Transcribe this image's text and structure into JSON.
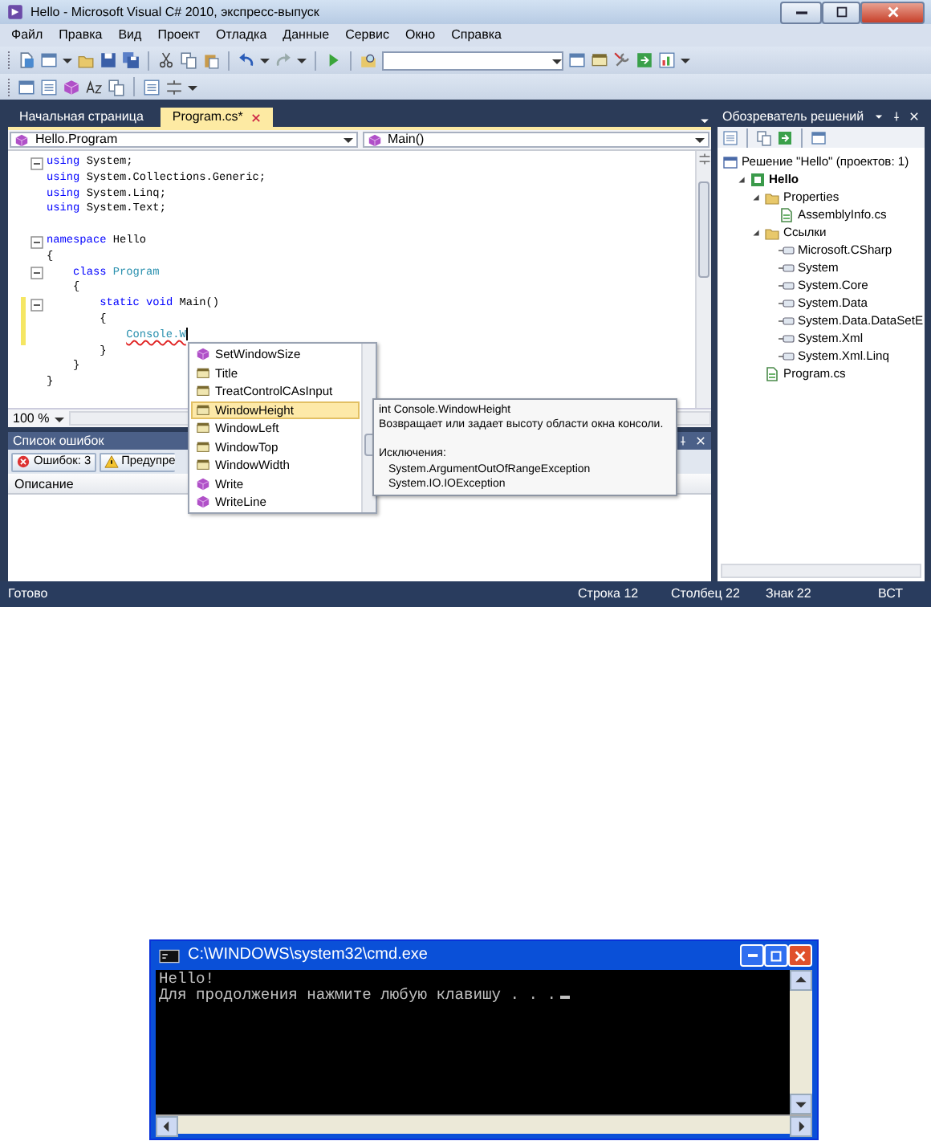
{
  "ide": {
    "title": "Hello - Microsoft Visual C# 2010, экспресс-выпуск",
    "menu": [
      "Файл",
      "Правка",
      "Вид",
      "Проект",
      "Отладка",
      "Данные",
      "Сервис",
      "Окно",
      "Справка"
    ],
    "tabs": [
      {
        "label": "Начальная страница",
        "selected": false
      },
      {
        "label": "Program.cs*",
        "selected": true
      }
    ],
    "editor": {
      "type_combo": "Hello.Program",
      "member_combo": "Main()",
      "zoom": "100 %",
      "lines": [
        {
          "fold": true,
          "changed": false,
          "tokens": [
            {
              "text": "using",
              "kind": "keyword"
            },
            {
              "text": " System;",
              "kind": "plain"
            }
          ]
        },
        {
          "fold": false,
          "changed": false,
          "tokens": [
            {
              "text": "using",
              "kind": "keyword"
            },
            {
              "text": " System.Collections.Generic;",
              "kind": "plain"
            }
          ]
        },
        {
          "fold": false,
          "changed": false,
          "tokens": [
            {
              "text": "using",
              "kind": "keyword"
            },
            {
              "text": " System.Linq;",
              "kind": "plain"
            }
          ]
        },
        {
          "fold": false,
          "changed": false,
          "tokens": [
            {
              "text": "using",
              "kind": "keyword"
            },
            {
              "text": " System.Text;",
              "kind": "plain"
            }
          ]
        },
        {
          "fold": true,
          "changed": false,
          "blank_before": true,
          "tokens": [
            {
              "text": "namespace",
              "kind": "keyword"
            },
            {
              "text": " Hello",
              "kind": "plain"
            }
          ]
        },
        {
          "fold": false,
          "changed": false,
          "tokens": [
            {
              "text": "{",
              "kind": "plain"
            }
          ]
        },
        {
          "fold": true,
          "changed": false,
          "tokens": [
            {
              "text": "    class",
              "kind": "keyword"
            },
            {
              "text": " Program",
              "kind": "type"
            }
          ]
        },
        {
          "fold": false,
          "changed": false,
          "tokens": [
            {
              "text": "    {",
              "kind": "plain"
            }
          ]
        },
        {
          "fold": true,
          "changed": true,
          "tokens": [
            {
              "text": "        static void",
              "kind": "keyword"
            },
            {
              "text": " Main()",
              "kind": "plain"
            }
          ]
        },
        {
          "fold": false,
          "changed": true,
          "tokens": [
            {
              "text": "        {",
              "kind": "plain"
            }
          ]
        },
        {
          "fold": false,
          "changed": true,
          "tokens": [
            {
              "text": "            Console.W",
              "kind": "error"
            }
          ]
        },
        {
          "fold": false,
          "changed": false,
          "tokens": [
            {
              "text": "        }",
              "kind": "plain"
            }
          ]
        },
        {
          "fold": false,
          "changed": false,
          "tokens": [
            {
              "text": "    }",
              "kind": "plain"
            }
          ]
        },
        {
          "fold": false,
          "changed": false,
          "tokens": [
            {
              "text": "}",
              "kind": "plain"
            }
          ]
        }
      ]
    },
    "completion": {
      "items": [
        {
          "label": "SetWindowSize",
          "kind": "method",
          "selected": false
        },
        {
          "label": "Title",
          "kind": "property",
          "selected": false
        },
        {
          "label": "TreatControlCAsInput",
          "kind": "property",
          "selected": false
        },
        {
          "label": "WindowHeight",
          "kind": "property",
          "selected": true
        },
        {
          "label": "WindowLeft",
          "kind": "property",
          "selected": false
        },
        {
          "label": "WindowTop",
          "kind": "property",
          "selected": false
        },
        {
          "label": "WindowWidth",
          "kind": "property",
          "selected": false
        },
        {
          "label": "Write",
          "kind": "method",
          "selected": false
        },
        {
          "label": "WriteLine",
          "kind": "method",
          "selected": false
        }
      ]
    },
    "tooltip": {
      "signature": "int Console.WindowHeight",
      "description": "Возвращает или задает высоту области окна консоли.",
      "exceptions_heading": "Исключения:",
      "exceptions": [
        "System.ArgumentOutOfRangeException",
        "System.IO.IOException"
      ]
    },
    "error_list": {
      "title": "Список ошибок",
      "filters": [
        {
          "label": "Ошибок: 3",
          "kind": "error"
        },
        {
          "label": "Предупре",
          "kind": "warning"
        }
      ],
      "columns": [
        "Описание"
      ]
    },
    "solution_explorer": {
      "title": "Обозреватель решений",
      "tree": [
        {
          "label": "Решение \"Hello\"  (проектов: 1)",
          "kind": "solution",
          "children": [
            {
              "label": "Hello",
              "kind": "project",
              "expanded": true,
              "children": [
                {
                  "label": "Properties",
                  "kind": "folder",
                  "expanded": true,
                  "children": [
                    {
                      "label": "AssemblyInfo.cs",
                      "kind": "file"
                    }
                  ]
                },
                {
                  "label": "Ссылки",
                  "kind": "folder",
                  "expanded": true,
                  "children": [
                    {
                      "label": "Microsoft.CSharp",
                      "kind": "reference"
                    },
                    {
                      "label": "System",
                      "kind": "reference"
                    },
                    {
                      "label": "System.Core",
                      "kind": "reference"
                    },
                    {
                      "label": "System.Data",
                      "kind": "reference"
                    },
                    {
                      "label": "System.Data.DataSetE",
                      "kind": "reference"
                    },
                    {
                      "label": "System.Xml",
                      "kind": "reference"
                    },
                    {
                      "label": "System.Xml.Linq",
                      "kind": "reference"
                    }
                  ]
                },
                {
                  "label": "Program.cs",
                  "kind": "file"
                }
              ]
            }
          ]
        }
      ]
    },
    "status_bar": {
      "message": "Готово",
      "line": "Строка 12",
      "column": "Столбец 22",
      "char": "Знак 22",
      "mode": "ВСТ"
    }
  },
  "console": {
    "title": "C:\\WINDOWS\\system32\\cmd.exe",
    "lines": [
      "Hello!",
      "Для продолжения нажмите любую клавишу . . ."
    ]
  }
}
